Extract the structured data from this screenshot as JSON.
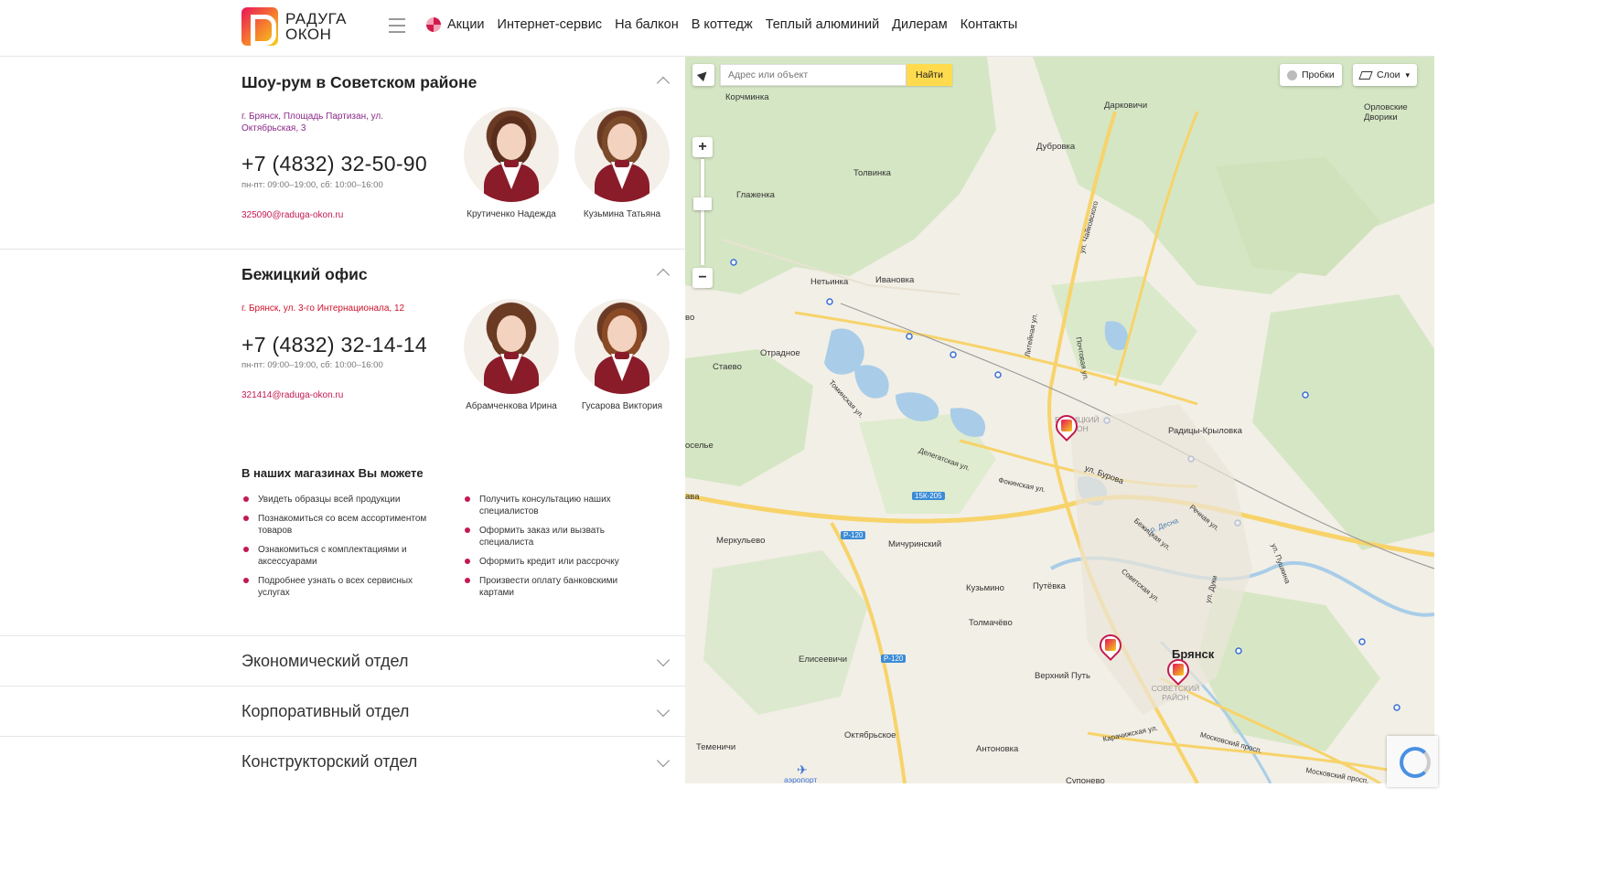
{
  "header": {
    "logo": {
      "line1": "РАДУГА",
      "line2": "ОКОН"
    },
    "nav": [
      {
        "label": "Акции",
        "icon": "promo-flower-icon"
      },
      {
        "label": "Интернет-сервис"
      },
      {
        "label": "На балкон"
      },
      {
        "label": "В коттедж"
      },
      {
        "label": "Теплый алюминий"
      },
      {
        "label": "Дилерам"
      },
      {
        "label": "Контакты"
      }
    ]
  },
  "offices": [
    {
      "title": "Шоу-рум в Советском районе",
      "address": "г. Брянск, Площадь Партизан, ул. Октябрьская, 3",
      "address_color": "#8c2a8a",
      "phone": "+7 (4832) 32-50-90",
      "hours": "пн-пт: 09:00–19:00, сб: 10:00–16:00",
      "email": "325090@raduga-okon.ru",
      "staff": [
        {
          "name": "Крутиченко Надежда"
        },
        {
          "name": "Кузьмина Татьяна"
        }
      ]
    },
    {
      "title": "Бежицкий офис",
      "address": "г. Брянск, ул. 3-го Интернационала, 12",
      "address_color": "#d0112b",
      "phone": "+7 (4832) 32-14-14",
      "hours": "пн-пт: 09:00–19:00, сб: 10:00–16:00",
      "email": "321414@raduga-okon.ru",
      "staff": [
        {
          "name": "Абрамченкова Ирина"
        },
        {
          "name": "Гусарова Виктория"
        }
      ]
    }
  ],
  "features": {
    "title": "В наших магазинах Вы можете",
    "left": [
      "Увидеть образцы всей продукции",
      "Познакомиться со всем ассортиментом товаров",
      "Ознакомиться с комплектациями и аксессуарами",
      "Подробнее узнать о всех сервисных услугах"
    ],
    "right": [
      "Получить консультацию наших специалистов",
      "Оформить заказ или вызвать специалиста",
      "Оформить кредит или рассрочку",
      "Произвести оплату банковскими картами"
    ]
  },
  "departments": [
    "Экономический отдел",
    "Корпоративный отдел",
    "Конструкторский отдел"
  ],
  "map": {
    "search_placeholder": "Адрес или объект",
    "find_label": "Найти",
    "traffic_label": "Пробки",
    "layers_label": "Слои",
    "zoom_in": "+",
    "zoom_out": "−",
    "labels": {
      "korchminka": "Корчминка",
      "darkovichi": "Дарковичи",
      "orlovskie": "Орловские Дворики",
      "dubrovka": "Дубровка",
      "tolvinka": "Толвинка",
      "glazhenka": "Глаженка",
      "netvinka": "Нетьинка",
      "ivanovka": "Ивановка",
      "otradnoe": "Отрадное",
      "staevo": "Стаево",
      "radicy": "Радицы-Крыловка",
      "merkulevo": "Меркульево",
      "michurinsky": "Мичуринский",
      "kuzmino": "Кузьмино",
      "putevka": "Путёвка",
      "tolmachevo": "Толмачёво",
      "elisеevichi": "Елисеевичи",
      "verhniy": "Верхний Путь",
      "oktyabrskoe": "Октябрьское",
      "temenichi": "Теменичи",
      "antonovka": "Антоновка",
      "bryansk": "Брянск",
      "sovetsky": "СОВЕТСКИЙ РАЙОН",
      "bezhitsky": "БЕЖИЦКИЙ РАЙОН",
      "r120a": "Р-120",
      "r120b": "Р-120",
      "sk205": "15К-205",
      "ul_burova": "ул. Бурова",
      "ul_litejnaya": "Литейная ул.",
      "ul_moskovsky": "Московский просп.",
      "ul_karachizhskaya": "Карачижская ул.",
      "ul_sovetskaya": "Советская ул.",
      "ul_delegatskaya": "Делегатская ул.",
      "ul_fokina": "Фокинская ул.",
      "ul_tomskaya": "Томинская ул.",
      "ul_pochtovaya": "Почтовая ул.",
      "ul_rechnaya": "Речная ул.",
      "desna": "р. Десна",
      "ul_pushkina": "ул. Пушкина",
      "ul_duki": "ул. Дуки",
      "ul_bezhitskaya": "Бежицкая ул.",
      "ul_chajkovskogo": "ул. Чайковского",
      "oselye": "оселье",
      "vo": "во",
      "ava": "ава",
      "aeroport": "аэропорт",
      "suponevo": "Супонево",
      "moskovsky2": "Московский просп."
    }
  },
  "colors": {
    "accent": "#c3194f",
    "map_bg": "#f2efe6",
    "forest": "#d5e6c4",
    "water": "#a9cde8",
    "road": "#f7d36a"
  }
}
